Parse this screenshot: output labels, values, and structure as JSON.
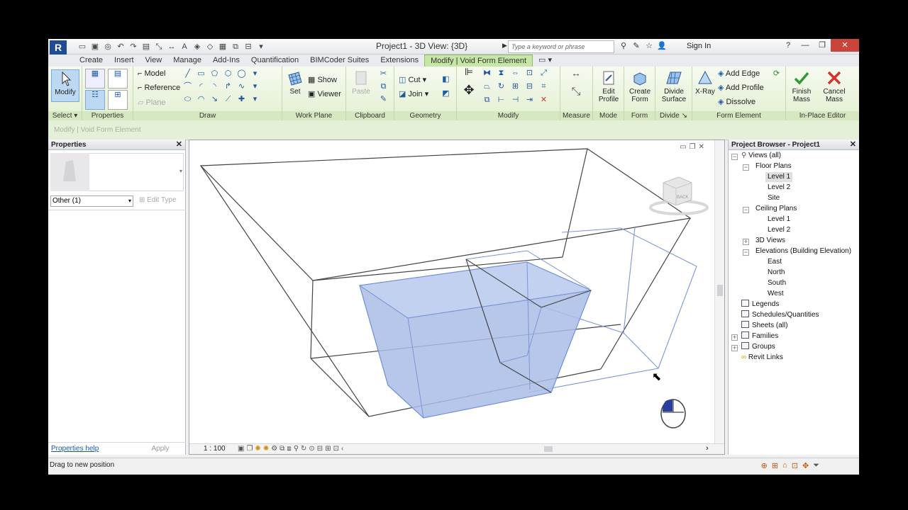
{
  "title_bar": {
    "title": "Project1 - 3D View: {3D}",
    "search_placeholder": "Type a keyword or phrase",
    "sign_in": "Sign In",
    "app_logo": "R"
  },
  "tabs": [
    "Create",
    "Insert",
    "View",
    "Manage",
    "Add-Ins",
    "Quantification",
    "BIMCoder Suites",
    "Extensions",
    "Modify | Void Form Element"
  ],
  "ribbon": {
    "select": {
      "button": "Modify",
      "label": "Select ▾"
    },
    "properties": {
      "label": "Properties"
    },
    "draw": {
      "model": "Model",
      "reference": "Reference",
      "plane": "Plane",
      "label": "Draw"
    },
    "work_plane": {
      "set": "Set",
      "show": "Show",
      "viewer": "Viewer",
      "label": "Work Plane"
    },
    "clipboard": {
      "paste": "Paste",
      "label": "Clipboard"
    },
    "geometry": {
      "cut": "Cut",
      "join": "Join",
      "label": "Geometry"
    },
    "modify": {
      "label": "Modify"
    },
    "measure": {
      "label": "Measure"
    },
    "mode": {
      "button": "Edit Profile",
      "label": "Mode"
    },
    "form": {
      "button": "Create Form",
      "label": "Form"
    },
    "divide": {
      "button": "Divide Surface",
      "label": "Divide ↘"
    },
    "form_element": {
      "xray": "X-Ray",
      "add_edge": "Add Edge",
      "add_profile": "Add Profile",
      "dissolve": "Dissolve",
      "label": "Form Element"
    },
    "in_place": {
      "finish": "Finish Mass",
      "cancel": "Cancel Mass",
      "label": "In-Place Editor"
    }
  },
  "options_bar": {
    "context": "Modify | Void Form Element"
  },
  "properties_pane": {
    "title": "Properties",
    "filter": "Other (1)",
    "edit_type": "Edit Type",
    "help": "Properties help",
    "apply": "Apply"
  },
  "viewport": {
    "scale": "1 : 100",
    "viewcube_face": "BACK"
  },
  "project_browser": {
    "title": "Project Browser - Project1",
    "nodes": {
      "views": "Views (all)",
      "floor_plans": "Floor Plans",
      "fp_level1": "Level 1",
      "fp_level2": "Level 2",
      "fp_site": "Site",
      "ceiling_plans": "Ceiling Plans",
      "cp_level1": "Level 1",
      "cp_level2": "Level 2",
      "views_3d": "3D Views",
      "elevations": "Elevations (Building Elevation)",
      "east": "East",
      "north": "North",
      "south": "South",
      "west": "West",
      "legends": "Legends",
      "schedules": "Schedules/Quantities",
      "sheets": "Sheets (all)",
      "families": "Families",
      "groups": "Groups",
      "revit_links": "Revit Links"
    }
  },
  "status_bar": {
    "text": "Drag to new position"
  },
  "colors": {
    "void_fill": "#a9bde6",
    "void_edge": "#6f8fd6",
    "ribbon_green": "#e3f0d2",
    "tab_active": "#c6e6a6"
  }
}
